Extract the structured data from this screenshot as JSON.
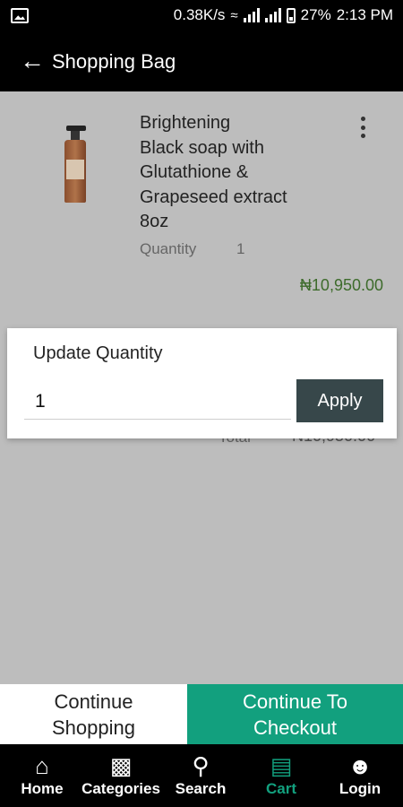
{
  "status_bar": {
    "speed": "0.38K/s",
    "battery": "27%",
    "time": "2:13 PM"
  },
  "app_bar": {
    "title": "Shopping Bag",
    "back_icon": "arrow-back-icon"
  },
  "cart_item": {
    "name_lines": [
      "Brightening",
      "Black soap with",
      "Glutathione &",
      "Grapeseed extract",
      "8oz"
    ],
    "quantity_label": "Quantity",
    "quantity_value": "1",
    "price": "₦10,950.00"
  },
  "summary": {
    "total_label": "Total",
    "total_value": "₦10,950.00"
  },
  "dialog": {
    "title": "Update Quantity",
    "input_value": "1",
    "apply_label": "Apply"
  },
  "actions": {
    "continue_shopping_lines": [
      "Continue",
      "Shopping"
    ],
    "checkout_lines": [
      "Continue To",
      "Checkout"
    ]
  },
  "bottom_nav": {
    "items": [
      {
        "label": "Home",
        "icon": "home-icon"
      },
      {
        "label": "Categories",
        "icon": "categories-icon"
      },
      {
        "label": "Search",
        "icon": "search-icon"
      },
      {
        "label": "Cart",
        "icon": "cart-icon",
        "active": true
      },
      {
        "label": "Login",
        "icon": "user-icon"
      }
    ]
  },
  "colors": {
    "accent": "#12a07e",
    "price": "#3d6b2b",
    "apply_button": "#37474a",
    "overlay_bg": "#bdbdbd"
  }
}
